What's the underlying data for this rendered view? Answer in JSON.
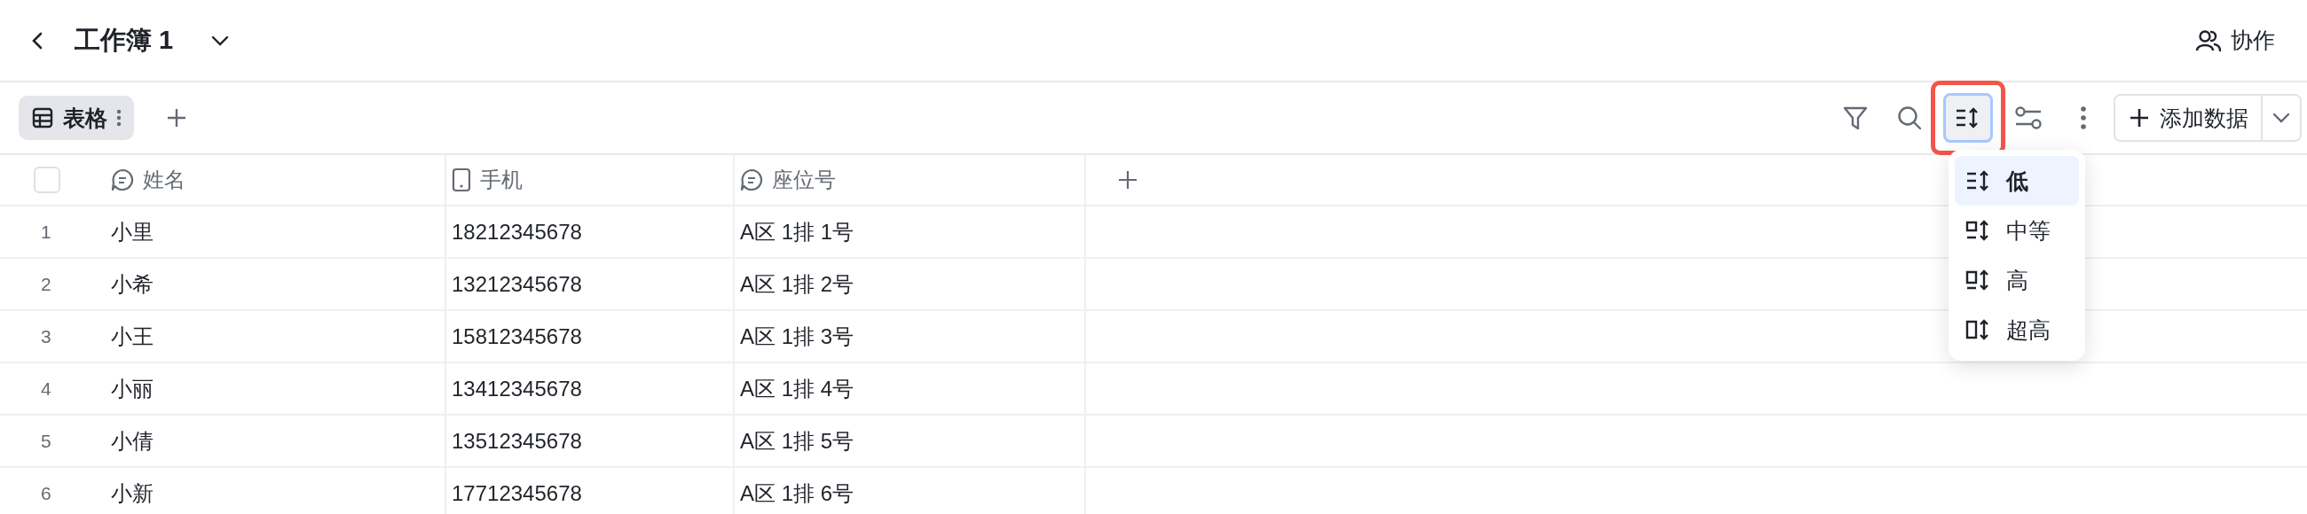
{
  "header": {
    "title": "工作簿 1",
    "collaborate": "协作"
  },
  "views": [
    {
      "label": "表格",
      "selected": true
    }
  ],
  "toolbar": {
    "row_height_expanded": true,
    "add_button": "添加数据"
  },
  "row_height_menu": [
    {
      "label": "低",
      "kind": "low",
      "selected": true
    },
    {
      "label": "中等",
      "kind": "medium",
      "selected": false
    },
    {
      "label": "高",
      "kind": "high",
      "selected": false
    },
    {
      "label": "超高",
      "kind": "extra",
      "selected": false
    }
  ],
  "table": {
    "select_all_checked": false,
    "columns": [
      {
        "label": "姓名",
        "kind": "text"
      },
      {
        "label": "手机",
        "kind": "phone"
      },
      {
        "label": "座位号",
        "kind": "text"
      }
    ],
    "rows": [
      {
        "number": "1",
        "cells": [
          "小里",
          "18212345678",
          "A区 1排 1号"
        ]
      },
      {
        "number": "2",
        "cells": [
          "小希",
          "13212345678",
          "A区 1排 2号"
        ]
      },
      {
        "number": "3",
        "cells": [
          "小王",
          "15812345678",
          "A区 1排 3号"
        ]
      },
      {
        "number": "4",
        "cells": [
          "小丽",
          "13412345678",
          "A区 1排 4号"
        ]
      },
      {
        "number": "5",
        "cells": [
          "小倩",
          "13512345678",
          "A区 1排 5号"
        ]
      },
      {
        "number": "6",
        "cells": [
          "小新",
          "17712345678",
          "A区 1排 6号"
        ]
      }
    ]
  }
}
